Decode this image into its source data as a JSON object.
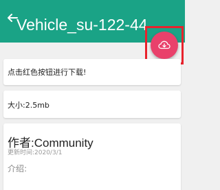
{
  "appbar": {
    "title": "Vehicle_su-122-44",
    "back_icon": "arrow-left-icon",
    "color": "#1aa386"
  },
  "fab": {
    "icon": "cloud-download-icon",
    "color": "#e9416b",
    "highlight_color": "#e8222c"
  },
  "cards": {
    "hint": "点击红色按钮进行下载!",
    "size": "大小:2.5mb",
    "author": "作者:Community",
    "updated": "更新时间:2020/3/1",
    "intro": "介绍:"
  }
}
